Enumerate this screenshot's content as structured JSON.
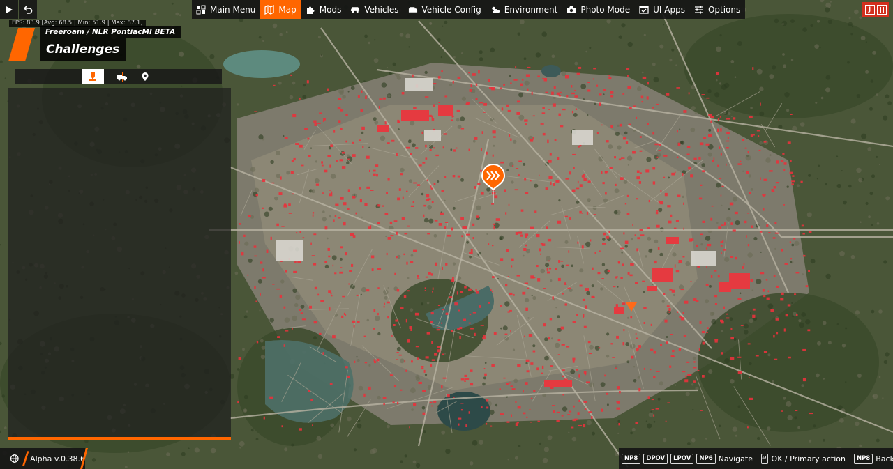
{
  "topbar": {
    "left_buttons": [
      {
        "icon": "play-icon"
      },
      {
        "icon": "undo-icon"
      }
    ],
    "menu": [
      {
        "label": "Main Menu",
        "icon": "main-menu-icon",
        "active": false
      },
      {
        "label": "Map",
        "icon": "map-icon",
        "active": true
      },
      {
        "label": "Mods",
        "icon": "puzzle-icon",
        "active": false
      },
      {
        "label": "Vehicles",
        "icon": "car-icon",
        "active": false
      },
      {
        "label": "Vehicle Config",
        "icon": "engine-icon",
        "active": false
      },
      {
        "label": "Environment",
        "icon": "weather-icon",
        "active": false
      },
      {
        "label": "Photo Mode",
        "icon": "camera-icon",
        "active": false
      },
      {
        "label": "UI Apps",
        "icon": "ui-apps-icon",
        "active": false
      },
      {
        "label": "Options",
        "icon": "sliders-icon",
        "active": false
      }
    ],
    "right_buttons": [
      {
        "icon": "j-icon",
        "text": "J"
      },
      {
        "icon": "pause-icon"
      }
    ]
  },
  "hud": {
    "fps": "FPS: 83.9 [Avg: 68.5 | Min: 51.9 | Max: 87.1]",
    "subtitle": "Freeroam / NLR PontiacMI BETA",
    "title": "Challenges"
  },
  "panel": {
    "tabs": [
      {
        "icon": "challenge-icon",
        "active": true
      },
      {
        "icon": "vehicle-trailer-icon",
        "active": false
      },
      {
        "icon": "location-pin-icon",
        "active": false
      }
    ]
  },
  "bottombar": {
    "version": "Alpha v.0.38.6",
    "hints": [
      {
        "keys": [
          "NP8",
          "DPOV",
          "LPOV",
          "NP6"
        ],
        "label": "Navigate"
      },
      {
        "keys": [
          "enter-icon"
        ],
        "label": "OK / Primary action"
      },
      {
        "keys": [
          "NP8"
        ],
        "label": "Back"
      }
    ]
  },
  "colors": {
    "accent": "#ff6600",
    "pause_button": "#d2301e",
    "bar_bg": "#141414",
    "building_red": "#e8323c"
  }
}
